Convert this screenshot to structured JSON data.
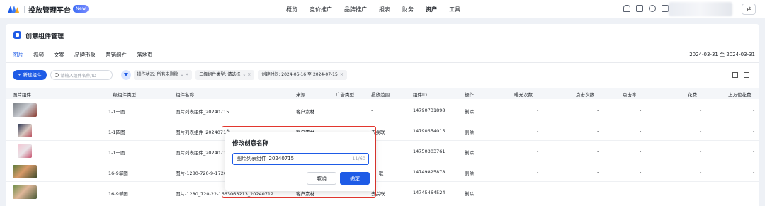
{
  "header": {
    "app_title": "投放管理平台",
    "badge": "New",
    "nav": [
      "概览",
      "竞价推广",
      "品牌推广",
      "报表",
      "财务",
      "资产",
      "工具"
    ],
    "active_nav": "资产",
    "switch_label": "⇄"
  },
  "page": {
    "title": "创意组件管理",
    "tabs": [
      "图片",
      "视频",
      "文案",
      "品牌形象",
      "营销组件",
      "落地页"
    ],
    "active_tab": "图片",
    "date_range": "2024-03-31 至 2024-03-31"
  },
  "toolbar": {
    "new_button": "+ 新建组件",
    "search_placeholder": "请输入组件名称/ID",
    "chips": [
      {
        "label": "操作状态: 所有未删除",
        "suffix": "⌄ ×"
      },
      {
        "label": "二级组件类型: 请选择",
        "suffix": "⌄ ×"
      },
      {
        "label": "创建时间: 2024-06-16 至 2024-07-15",
        "suffix": "×"
      }
    ]
  },
  "table": {
    "headers": [
      "图片组件",
      "二级组件类型",
      "组件名称",
      "来源",
      "广告类型",
      "投放范围",
      "组件ID",
      "操作",
      "曝光次数",
      "点击次数",
      "点击率",
      "花费",
      "上方位花费"
    ],
    "rows": [
      {
        "type": "1-1一图",
        "name": "图片列表组件_20240715",
        "source": "客户素材",
        "scope": "-",
        "id": "14790731898",
        "op": "删除",
        "m1": "-",
        "m2": "-",
        "m3": "-",
        "m4": "-",
        "m5": "-"
      },
      {
        "type": "1-1四图",
        "name": "图片列表组件_20240715",
        "source": "客户素材",
        "scope": "去关联",
        "id": "14790554015",
        "op": "删除",
        "m1": "-",
        "m2": "-",
        "m3": "-",
        "m4": "-",
        "m5": "-"
      },
      {
        "type": "1-1一图",
        "name": "图片列表组件_20240712",
        "source": "",
        "scope": "",
        "id": "14750303761",
        "op": "删除",
        "m1": "-",
        "m2": "-",
        "m3": "-",
        "m4": "-",
        "m5": "-"
      },
      {
        "type": "16-9单图",
        "name": "图片-1280-720-9-17207",
        "source": "",
        "scope": "联",
        "id": "14749825878",
        "op": "删除",
        "m1": "-",
        "m2": "-",
        "m3": "-",
        "m4": "-",
        "m5": "-"
      },
      {
        "type": "16-9单图",
        "name": "图片-1280_720-22-1663063213_20240712",
        "source": "客户素材",
        "scope": "去关联",
        "id": "14745464524",
        "op": "删除",
        "m1": "-",
        "m2": "-",
        "m3": "-",
        "m4": "-",
        "m5": "-"
      }
    ]
  },
  "modal": {
    "title": "修改创意名称",
    "input_value": "图片列表组件_20240715",
    "counter": "11/60",
    "cancel": "取消",
    "confirm": "确定"
  },
  "colors": {
    "primary": "#1e5be6",
    "highlight_outline": "#e2362e"
  }
}
